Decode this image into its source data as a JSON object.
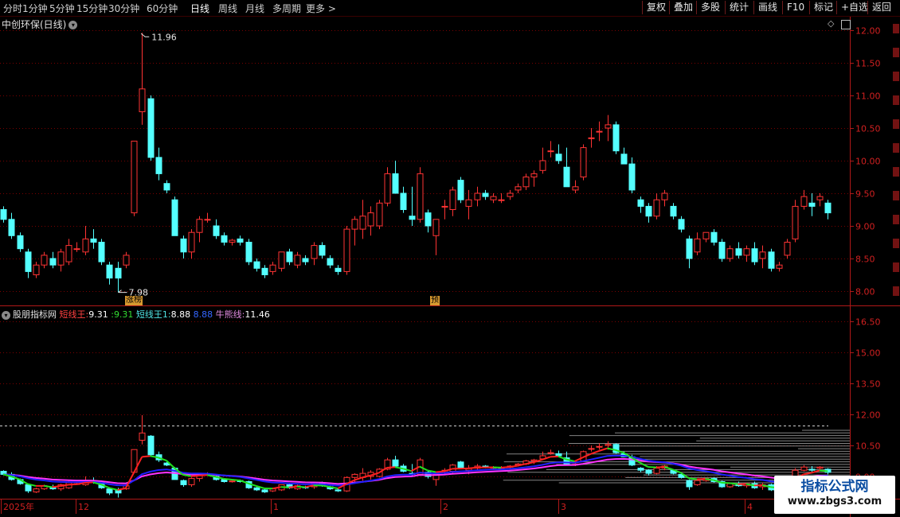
{
  "toolbar": {
    "periods": [
      "分时",
      "1分钟",
      "5分钟",
      "15分钟",
      "30分钟",
      "60分钟",
      "日线",
      "周线",
      "月线",
      "多周期",
      "更多 >"
    ],
    "active_period": "日线",
    "buttons": [
      "复权",
      "叠加",
      "多股",
      "统计",
      "画线",
      "F10",
      "标记",
      "+自选",
      "返回"
    ]
  },
  "main": {
    "title": "中创环保(日线)",
    "high_annotation": "11.96",
    "low_annotation": "7.98",
    "tag_limit": "涨榜",
    "tag_pre": "预",
    "yticks": [
      "12.00",
      "11.50",
      "11.00",
      "10.50",
      "10.00",
      "9.50",
      "9.00",
      "8.50",
      "8.00"
    ]
  },
  "indicator": {
    "name": "股朋指标网",
    "label1": "短线王:",
    "value1a": "9.31",
    "value1b": "9.31",
    "label2": "短线王1:",
    "value2a": "8.88",
    "value2b": "8.88",
    "label3": "牛熊线:",
    "value3": "11.46",
    "yticks": [
      "16.50",
      "15.00",
      "13.50",
      "12.00",
      "10.50",
      "9.00"
    ]
  },
  "xaxis": {
    "labels": [
      "2025年",
      "12",
      "1",
      "2",
      "3",
      "4"
    ]
  },
  "watermark": {
    "title": "指标公式网",
    "url": "www.zbgs3.com"
  },
  "colors": {
    "up": "#ff3333",
    "down": "#54ffff",
    "grid": "#7a0000",
    "axis": "#b01818",
    "line_short": "#ff2020",
    "line_short_alt": "#20e020",
    "line_short1": "#2020ff",
    "line_bull": "#ff33ff"
  },
  "chart_data": {
    "type": "candlestick",
    "ylim": [
      7.8,
      12.1
    ],
    "ylim_indicator": [
      8.7,
      17.2
    ],
    "candles": [
      [
        9.25,
        9.3,
        9.05,
        9.1
      ],
      [
        9.1,
        9.2,
        8.8,
        8.85
      ],
      [
        8.85,
        8.9,
        8.6,
        8.65
      ],
      [
        8.6,
        8.65,
        8.2,
        8.3
      ],
      [
        8.25,
        8.45,
        8.2,
        8.4
      ],
      [
        8.4,
        8.6,
        8.35,
        8.55
      ],
      [
        8.5,
        8.6,
        8.35,
        8.4
      ],
      [
        8.4,
        8.65,
        8.3,
        8.6
      ],
      [
        8.45,
        8.8,
        8.4,
        8.7
      ],
      [
        8.65,
        8.75,
        8.6,
        8.65
      ],
      [
        8.6,
        9.0,
        8.55,
        8.8
      ],
      [
        8.8,
        8.95,
        8.65,
        8.75
      ],
      [
        8.75,
        8.8,
        8.4,
        8.45
      ],
      [
        8.4,
        8.45,
        8.1,
        8.2
      ],
      [
        8.35,
        8.45,
        7.98,
        8.2
      ],
      [
        8.4,
        8.6,
        8.35,
        8.55
      ],
      [
        9.2,
        10.3,
        9.15,
        10.3
      ],
      [
        10.75,
        11.96,
        10.55,
        11.1
      ],
      [
        10.95,
        11.0,
        10.0,
        10.05
      ],
      [
        10.05,
        10.2,
        9.7,
        9.8
      ],
      [
        9.65,
        9.7,
        9.5,
        9.55
      ],
      [
        9.4,
        9.45,
        8.9,
        8.85
      ],
      [
        8.8,
        8.85,
        8.5,
        8.6
      ],
      [
        8.6,
        8.95,
        8.5,
        8.9
      ],
      [
        8.9,
        9.15,
        8.75,
        9.1
      ],
      [
        9.1,
        9.2,
        9.05,
        9.1
      ],
      [
        9.0,
        9.1,
        8.8,
        8.85
      ],
      [
        8.85,
        8.9,
        8.7,
        8.75
      ],
      [
        8.75,
        8.8,
        8.7,
        8.78
      ],
      [
        8.8,
        8.85,
        8.7,
        8.75
      ],
      [
        8.75,
        8.8,
        8.4,
        8.45
      ],
      [
        8.45,
        8.5,
        8.3,
        8.35
      ],
      [
        8.35,
        8.4,
        8.2,
        8.25
      ],
      [
        8.3,
        8.45,
        8.25,
        8.4
      ],
      [
        8.35,
        8.6,
        8.3,
        8.6
      ],
      [
        8.6,
        8.65,
        8.4,
        8.45
      ],
      [
        8.4,
        8.6,
        8.35,
        8.55
      ],
      [
        8.5,
        8.55,
        8.4,
        8.45
      ],
      [
        8.5,
        8.75,
        8.4,
        8.7
      ],
      [
        8.7,
        8.75,
        8.5,
        8.55
      ],
      [
        8.5,
        8.55,
        8.35,
        8.4
      ],
      [
        8.35,
        8.4,
        8.25,
        8.3
      ],
      [
        8.3,
        9.0,
        8.25,
        8.95
      ],
      [
        8.95,
        9.15,
        8.7,
        9.1
      ],
      [
        8.95,
        9.4,
        8.8,
        9.15
      ],
      [
        9.0,
        9.3,
        8.85,
        9.2
      ],
      [
        9.0,
        9.4,
        8.95,
        9.35
      ],
      [
        9.35,
        9.9,
        9.3,
        9.8
      ],
      [
        9.8,
        10.0,
        9.5,
        9.5
      ],
      [
        9.5,
        9.6,
        9.2,
        9.25
      ],
      [
        9.15,
        9.6,
        9.0,
        9.1
      ],
      [
        9.1,
        9.9,
        9.05,
        9.8
      ],
      [
        9.2,
        9.25,
        8.9,
        9.0
      ],
      [
        8.85,
        9.1,
        8.55,
        9.1
      ],
      [
        9.3,
        9.4,
        9.1,
        9.3
      ],
      [
        9.25,
        9.6,
        9.15,
        9.55
      ],
      [
        9.7,
        9.75,
        9.35,
        9.4
      ],
      [
        9.3,
        9.55,
        9.1,
        9.4
      ],
      [
        9.4,
        9.6,
        9.3,
        9.5
      ],
      [
        9.5,
        9.55,
        9.4,
        9.45
      ],
      [
        9.4,
        9.5,
        9.35,
        9.45
      ],
      [
        9.4,
        9.5,
        9.35,
        9.4
      ],
      [
        9.45,
        9.55,
        9.4,
        9.5
      ],
      [
        9.55,
        9.65,
        9.5,
        9.6
      ],
      [
        9.6,
        9.8,
        9.55,
        9.75
      ],
      [
        9.75,
        9.85,
        9.6,
        9.8
      ],
      [
        9.85,
        10.2,
        9.8,
        10.0
      ],
      [
        10.15,
        10.3,
        10.05,
        10.15
      ],
      [
        10.1,
        10.25,
        9.95,
        10.0
      ],
      [
        9.9,
        10.2,
        9.85,
        9.6
      ],
      [
        9.55,
        9.7,
        9.5,
        9.6
      ],
      [
        9.75,
        10.25,
        9.7,
        10.2
      ],
      [
        10.35,
        10.5,
        10.2,
        10.35
      ],
      [
        10.45,
        10.6,
        10.3,
        10.45
      ],
      [
        10.5,
        10.7,
        10.3,
        10.55
      ],
      [
        10.55,
        10.6,
        10.1,
        10.15
      ],
      [
        10.1,
        10.2,
        9.95,
        9.95
      ],
      [
        9.95,
        10.05,
        9.5,
        9.55
      ],
      [
        9.4,
        9.45,
        9.2,
        9.3
      ],
      [
        9.3,
        9.35,
        9.05,
        9.15
      ],
      [
        9.15,
        9.5,
        9.1,
        9.4
      ],
      [
        9.4,
        9.55,
        9.3,
        9.5
      ],
      [
        9.3,
        9.35,
        9.1,
        9.15
      ],
      [
        9.1,
        9.15,
        8.9,
        8.95
      ],
      [
        8.8,
        8.85,
        8.35,
        8.5
      ],
      [
        8.6,
        8.9,
        8.55,
        8.8
      ],
      [
        8.8,
        8.9,
        8.75,
        8.9
      ],
      [
        8.9,
        8.95,
        8.7,
        8.75
      ],
      [
        8.75,
        8.8,
        8.45,
        8.5
      ],
      [
        8.5,
        8.7,
        8.45,
        8.65
      ],
      [
        8.65,
        8.75,
        8.5,
        8.55
      ],
      [
        8.55,
        8.7,
        8.45,
        8.65
      ],
      [
        8.65,
        8.75,
        8.4,
        8.45
      ],
      [
        8.5,
        8.7,
        8.35,
        8.6
      ],
      [
        8.6,
        8.65,
        8.3,
        8.35
      ],
      [
        8.35,
        8.45,
        8.3,
        8.4
      ],
      [
        8.55,
        8.8,
        8.5,
        8.75
      ],
      [
        8.8,
        9.4,
        8.75,
        9.3
      ],
      [
        9.3,
        9.55,
        9.25,
        9.45
      ],
      [
        9.35,
        9.5,
        9.15,
        9.3
      ],
      [
        9.4,
        9.5,
        9.3,
        9.45
      ],
      [
        9.35,
        9.4,
        9.1,
        9.2
      ]
    ]
  }
}
